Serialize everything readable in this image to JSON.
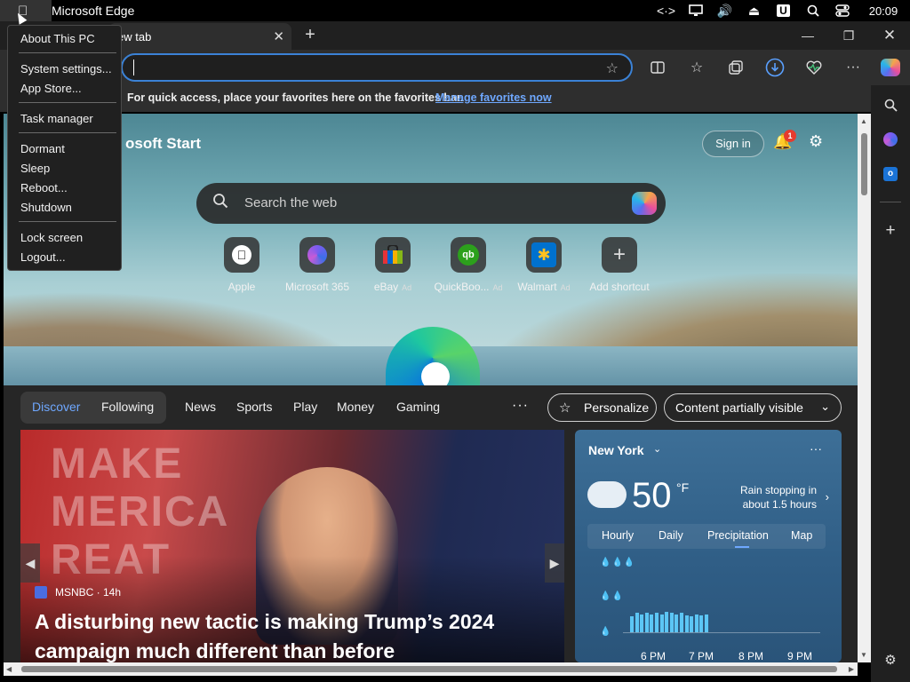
{
  "os_bar": {
    "app_name": "Microsoft Edge",
    "clock": "20:09",
    "tray_u_label": "U"
  },
  "browser": {
    "tab_title": "ew tab",
    "favorites_bar": {
      "message": "For quick access, place your favorites here on the favorites bar.",
      "link": "Manage favorites now"
    }
  },
  "apple_menu": {
    "items": [
      "About This PC",
      "System settings...",
      "App Store...",
      "Task manager",
      "Dormant",
      "Sleep",
      "Reboot...",
      "Shutdown",
      "Lock screen",
      "Logout..."
    ]
  },
  "start_page": {
    "brand": "osoft Start",
    "sign_in": "Sign in",
    "notification_count": "1",
    "search_placeholder": "Search the web",
    "shortcuts": [
      {
        "label": "Apple",
        "ad": "",
        "glyph": ""
      },
      {
        "label": "Microsoft 365",
        "ad": "",
        "glyph": ""
      },
      {
        "label": "eBay",
        "ad": "Ad",
        "glyph": ""
      },
      {
        "label": "QuickBoo...",
        "ad": "Ad",
        "glyph": "qb"
      },
      {
        "label": "Walmart",
        "ad": "Ad",
        "glyph": "✱"
      },
      {
        "label": "Add shortcut",
        "ad": "",
        "glyph": "+"
      }
    ]
  },
  "feed": {
    "nav": [
      "Discover",
      "Following",
      "News",
      "Sports",
      "Play",
      "Money",
      "Gaming"
    ],
    "more": "···",
    "personalize": "Personalize",
    "content_visibility": "Content partially visible",
    "hero": {
      "image_text": "MAKE\nMERICA\nREAT",
      "source": "MSNBC · 14h",
      "headline": "A disturbing new tactic is making Trump’s 2024 campaign much different than before"
    }
  },
  "weather": {
    "city": "New York",
    "temperature": "50",
    "unit": "°F",
    "rain_line1": "Rain stopping in",
    "rain_line2": "about 1.5 hours",
    "tabs": [
      "Hourly",
      "Daily",
      "Precipitation",
      "Map"
    ],
    "active_tab": "Precipitation",
    "times": [
      "6 PM",
      "7 PM",
      "8 PM",
      "9 PM"
    ],
    "precip_bars": [
      0.75,
      0.9,
      0.85,
      0.9,
      0.85,
      0.9,
      0.85,
      0.95,
      0.9,
      0.85,
      0.9,
      0.8,
      0.75,
      0.85,
      0.8,
      0.85
    ]
  }
}
